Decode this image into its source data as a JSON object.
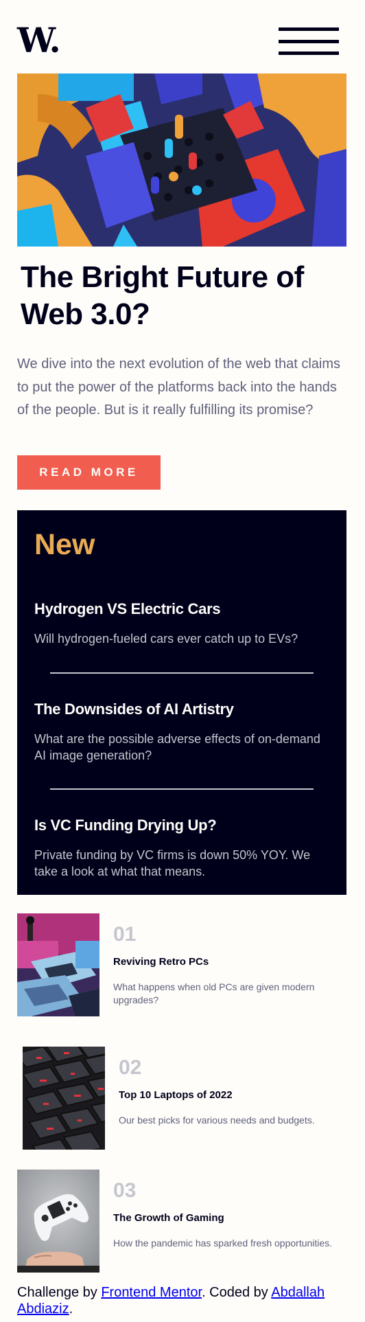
{
  "header": {
    "logo_text": "W."
  },
  "hero": {
    "title": "The Bright Future of Web 3.0?",
    "description": "We dive into the next evolution of the web that claims to put the power of the platforms back into the hands of the people. But is it really fulfilling its promise?",
    "button_label": "READ MORE"
  },
  "new_section": {
    "title": "New",
    "items": [
      {
        "title": "Hydrogen VS Electric Cars",
        "description": "Will hydrogen-fueled cars ever catch up to EVs?"
      },
      {
        "title": "The Downsides of AI Artistry",
        "description": "What are the possible adverse effects of on-demand AI image generation?"
      },
      {
        "title": "Is VC Funding Drying Up?",
        "description": "Private funding by VC firms is down 50% YOY. We take a look at what that means."
      }
    ]
  },
  "articles": [
    {
      "number": "01",
      "title": "Reviving Retro PCs",
      "description": "What happens when old PCs are given modern upgrades?"
    },
    {
      "number": "02",
      "title": "Top 10 Laptops of 2022",
      "description": "Our best picks for various needs and budgets."
    },
    {
      "number": "03",
      "title": "The Growth of Gaming",
      "description": "How the pandemic has sparked fresh opportunities."
    }
  ],
  "footer": {
    "prefix": "Challenge by ",
    "link1": "Frontend Mentor",
    "middle": ". Coded by ",
    "link2": "Abdallah Abdiaziz",
    "suffix": "."
  },
  "colors": {
    "background": "#FFFDFA",
    "dark_navy": "#00001A",
    "soft_red": "#F15E50",
    "soft_orange": "#E9AB53",
    "grayish_blue": "#C5C6CE",
    "dark_grayish_blue": "#5E607A"
  }
}
